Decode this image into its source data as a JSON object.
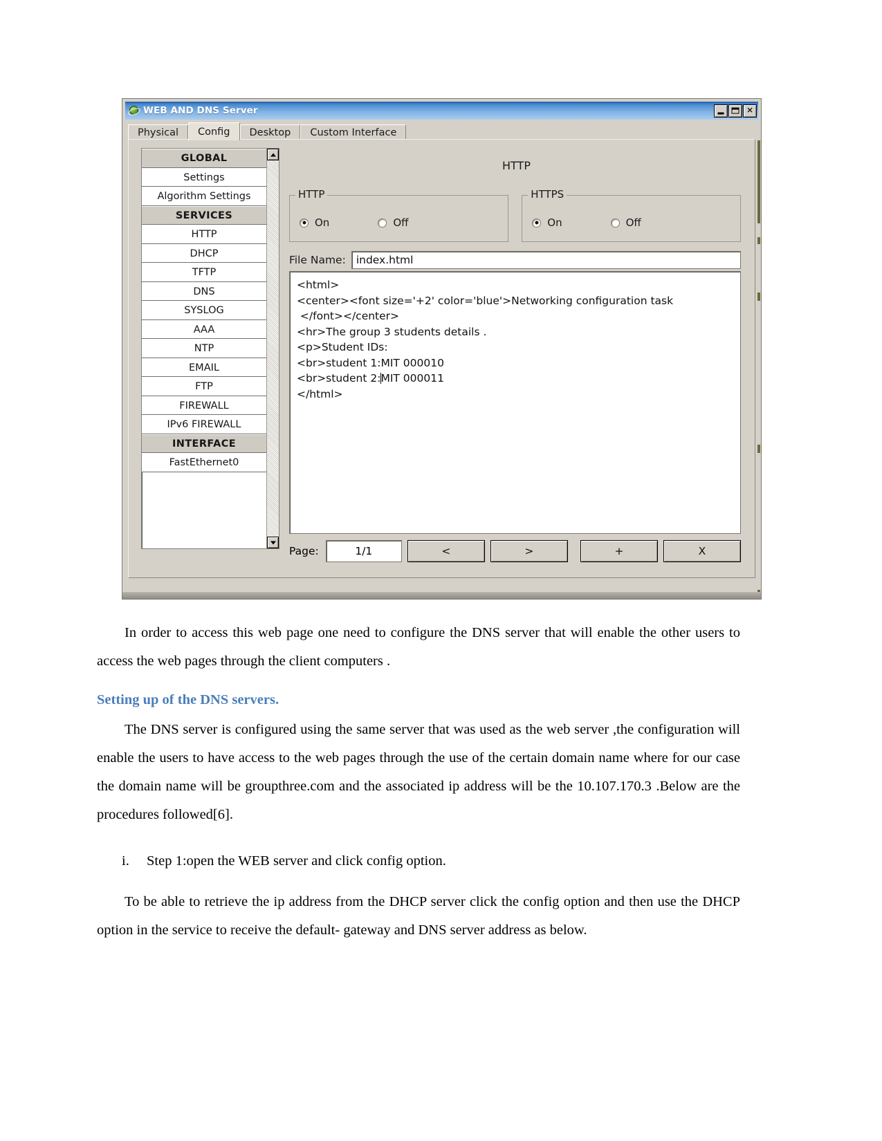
{
  "window": {
    "title": "WEB AND DNS Server",
    "icon": "globe-icon",
    "controls": {
      "minimize": "_",
      "maximize": "□",
      "close": "✕"
    },
    "tabs": [
      {
        "label": "Physical",
        "active": false
      },
      {
        "label": "Config",
        "active": true
      },
      {
        "label": "Desktop",
        "active": false
      },
      {
        "label": "Custom Interface",
        "active": false
      }
    ],
    "sidebar": {
      "items": [
        {
          "label": "GLOBAL",
          "type": "group"
        },
        {
          "label": "Settings",
          "type": "item"
        },
        {
          "label": "Algorithm Settings",
          "type": "item"
        },
        {
          "label": "SERVICES",
          "type": "group"
        },
        {
          "label": "HTTP",
          "type": "item"
        },
        {
          "label": "DHCP",
          "type": "item"
        },
        {
          "label": "TFTP",
          "type": "item"
        },
        {
          "label": "DNS",
          "type": "item"
        },
        {
          "label": "SYSLOG",
          "type": "item"
        },
        {
          "label": "AAA",
          "type": "item"
        },
        {
          "label": "NTP",
          "type": "item"
        },
        {
          "label": "EMAIL",
          "type": "item"
        },
        {
          "label": "FTP",
          "type": "item"
        },
        {
          "label": "FIREWALL",
          "type": "item"
        },
        {
          "label": "IPv6 FIREWALL",
          "type": "item"
        },
        {
          "label": "INTERFACE",
          "type": "group"
        },
        {
          "label": "FastEthernet0",
          "type": "item"
        }
      ]
    },
    "content": {
      "title": "HTTP",
      "http_group": {
        "legend": "HTTP",
        "on_label": "On",
        "off_label": "Off",
        "selected": "On"
      },
      "https_group": {
        "legend": "HTTPS",
        "on_label": "On",
        "off_label": "Off",
        "selected": "On"
      },
      "file_name_label": "File Name:",
      "file_name_value": "index.html",
      "code_lines": [
        "<html>",
        "<center><font size='+2' color='blue'>Networking configuration task",
        " </font></center>",
        "<hr>The group 3 students details .",
        "<p>Student IDs:",
        "<br>student 1:MIT 000010",
        "<br>student 2:MIT 000011",
        "</html>"
      ],
      "page_label": "Page:",
      "page_value": "1/1",
      "prev_label": "<",
      "next_label": ">",
      "add_label": "+",
      "delete_label": "X"
    }
  },
  "document": {
    "paragraph_1": "In order to access this web page one need to configure the DNS server that will enable the other users to access the web pages through the client computers .",
    "heading_1": "Setting up of the DNS servers.",
    "paragraph_2": "The DNS server is configured using the same server that was used as the web server ,the configuration will enable the users to have access to the web pages through the use of the certain domain name where for our case the domain name will be groupthree.com and the associated ip address will be the 10.107.170.3 .Below are the procedures followed[6].",
    "list_item_marker": "i.",
    "list_item_text": "Step 1:open the WEB server and click config option.",
    "paragraph_3": "To be able to retrieve the ip address from the DHCP server click the config option and then use the DHCP option in the service to receive the default- gateway  and  DNS server address as below."
  },
  "colors": {
    "titlebar_blue": "#4f8ed0",
    "heading_blue": "#4a7ebb",
    "panel_gray": "#d5d1c9"
  }
}
